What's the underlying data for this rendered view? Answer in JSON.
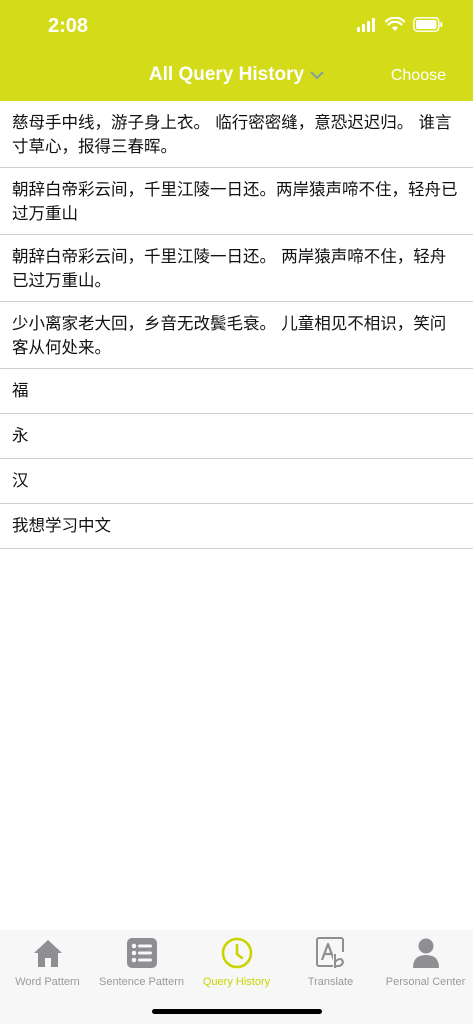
{
  "status": {
    "time": "2:08"
  },
  "nav": {
    "title": "All Query History",
    "right_action": "Choose"
  },
  "history": [
    "慈母手中线，游子身上衣。 临行密密缝，意恐迟迟归。 谁言寸草心，报得三春晖。",
    "朝辞白帝彩云间，千里江陵一日还。两岸猿声啼不住，轻舟已过万重山",
    "朝辞白帝彩云间，千里江陵一日还。 两岸猿声啼不住，轻舟已过万重山。",
    "少小离家老大回，乡音无改鬓毛衰。 儿童相见不相识，笑问客从何处来。",
    "福",
    "永",
    "汉",
    "我想学习中文"
  ],
  "tabs": [
    {
      "label": "Word Pattern",
      "icon": "home-icon",
      "active": false
    },
    {
      "label": "Sentence Pattern",
      "icon": "list-icon",
      "active": false
    },
    {
      "label": "Query History",
      "icon": "clock-icon",
      "active": true
    },
    {
      "label": "Translate",
      "icon": "translate-icon",
      "active": false
    },
    {
      "label": "Personal Center",
      "icon": "person-icon",
      "active": false
    }
  ],
  "colors": {
    "accent": "#d4dc1a",
    "tab_active": "#c9d400",
    "tab_inactive": "#9a9a9a"
  }
}
